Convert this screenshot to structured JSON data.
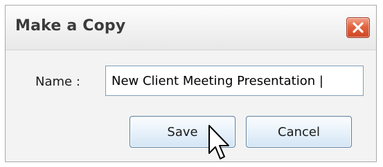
{
  "dialog": {
    "title": "Make a Copy",
    "close_icon": "close-icon",
    "name_label": "Name :",
    "name_value": "New Client Meeting Presentation |",
    "save_label": "Save",
    "cancel_label": "Cancel"
  },
  "colors": {
    "close_button": "#e2633f",
    "button_border": "#5a7ea0",
    "input_border": "#7f9db9"
  },
  "pointer": {
    "icon": "mouse-pointer-icon"
  }
}
